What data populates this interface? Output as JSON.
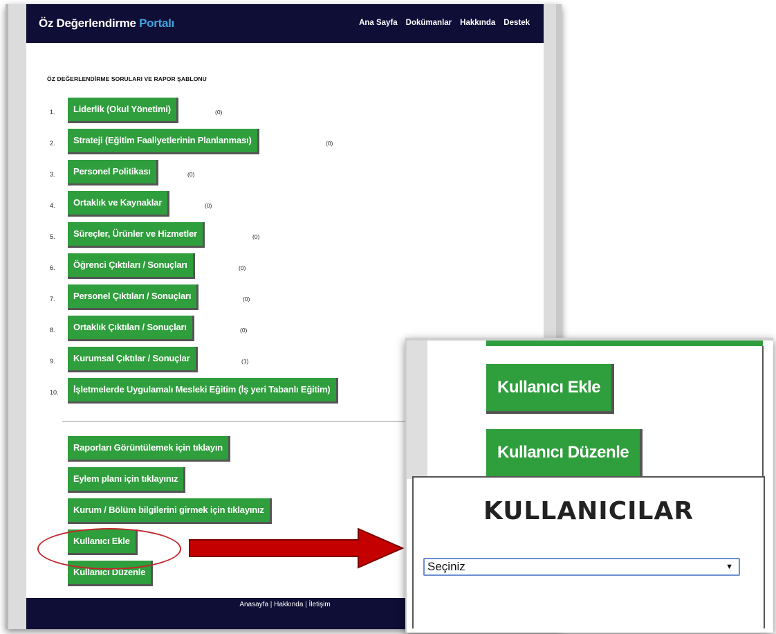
{
  "header": {
    "brand_main": "Öz Değerlendirme",
    "brand_accent": "Portalı",
    "nav": [
      "Ana Sayfa",
      "Dokümanlar",
      "Hakkında",
      "Destek"
    ]
  },
  "section_title": "ÖZ DEĞERLENDİRME SORULARI VE RAPOR ŞABLONU",
  "items": [
    {
      "num": "1.",
      "label": "Liderlik (Okul Yönetimi)",
      "count": "(0)"
    },
    {
      "num": "2.",
      "label": "Strateji (Eğitim Faaliyetlerinin Planlanması)",
      "count": "(0)"
    },
    {
      "num": "3.",
      "label": "Personel Politikası",
      "count": "(0)"
    },
    {
      "num": "4.",
      "label": "Ortaklık ve Kaynaklar",
      "count": "(0)"
    },
    {
      "num": "5.",
      "label": "Süreçler, Ürünler ve Hizmetler",
      "count": "(0)"
    },
    {
      "num": "6.",
      "label": "Öğrenci Çıktıları / Sonuçları",
      "count": "(0)"
    },
    {
      "num": "7.",
      "label": "Personel Çıktıları / Sonuçları",
      "count": "(0)"
    },
    {
      "num": "8.",
      "label": "Ortaklık Çıktıları / Sonuçları",
      "count": "(0)"
    },
    {
      "num": "9.",
      "label": "Kurumsal Çıktılar / Sonuçlar",
      "count": "(1)"
    },
    {
      "num": "10.",
      "label": "İşletmelerde Uygulamalı Mesleki Eğitim (İş yeri Tabanlı Eğitim)",
      "count": ""
    }
  ],
  "actions": [
    "Raporları Görüntülemek için tıklayın",
    "Eylem planı için tıklayınız",
    "Kurum / Bölüm bilgilerini girmek için tıklayınız",
    "Kullanıcı Ekle",
    "Kullanıcı Düzenle"
  ],
  "footer": "Anasayfa | Hakkında | İletişim",
  "zoom": {
    "add_user": "Kullanıcı Ekle",
    "edit_user": "Kullanıcı Düzenle",
    "heading": "KULLANICILAR",
    "select_value": "Seçiniz"
  },
  "colors": {
    "navy": "#0e0e36",
    "green": "#2f9e3c",
    "accent_blue": "#3fa6e0",
    "highlight_red": "#c0282d"
  }
}
